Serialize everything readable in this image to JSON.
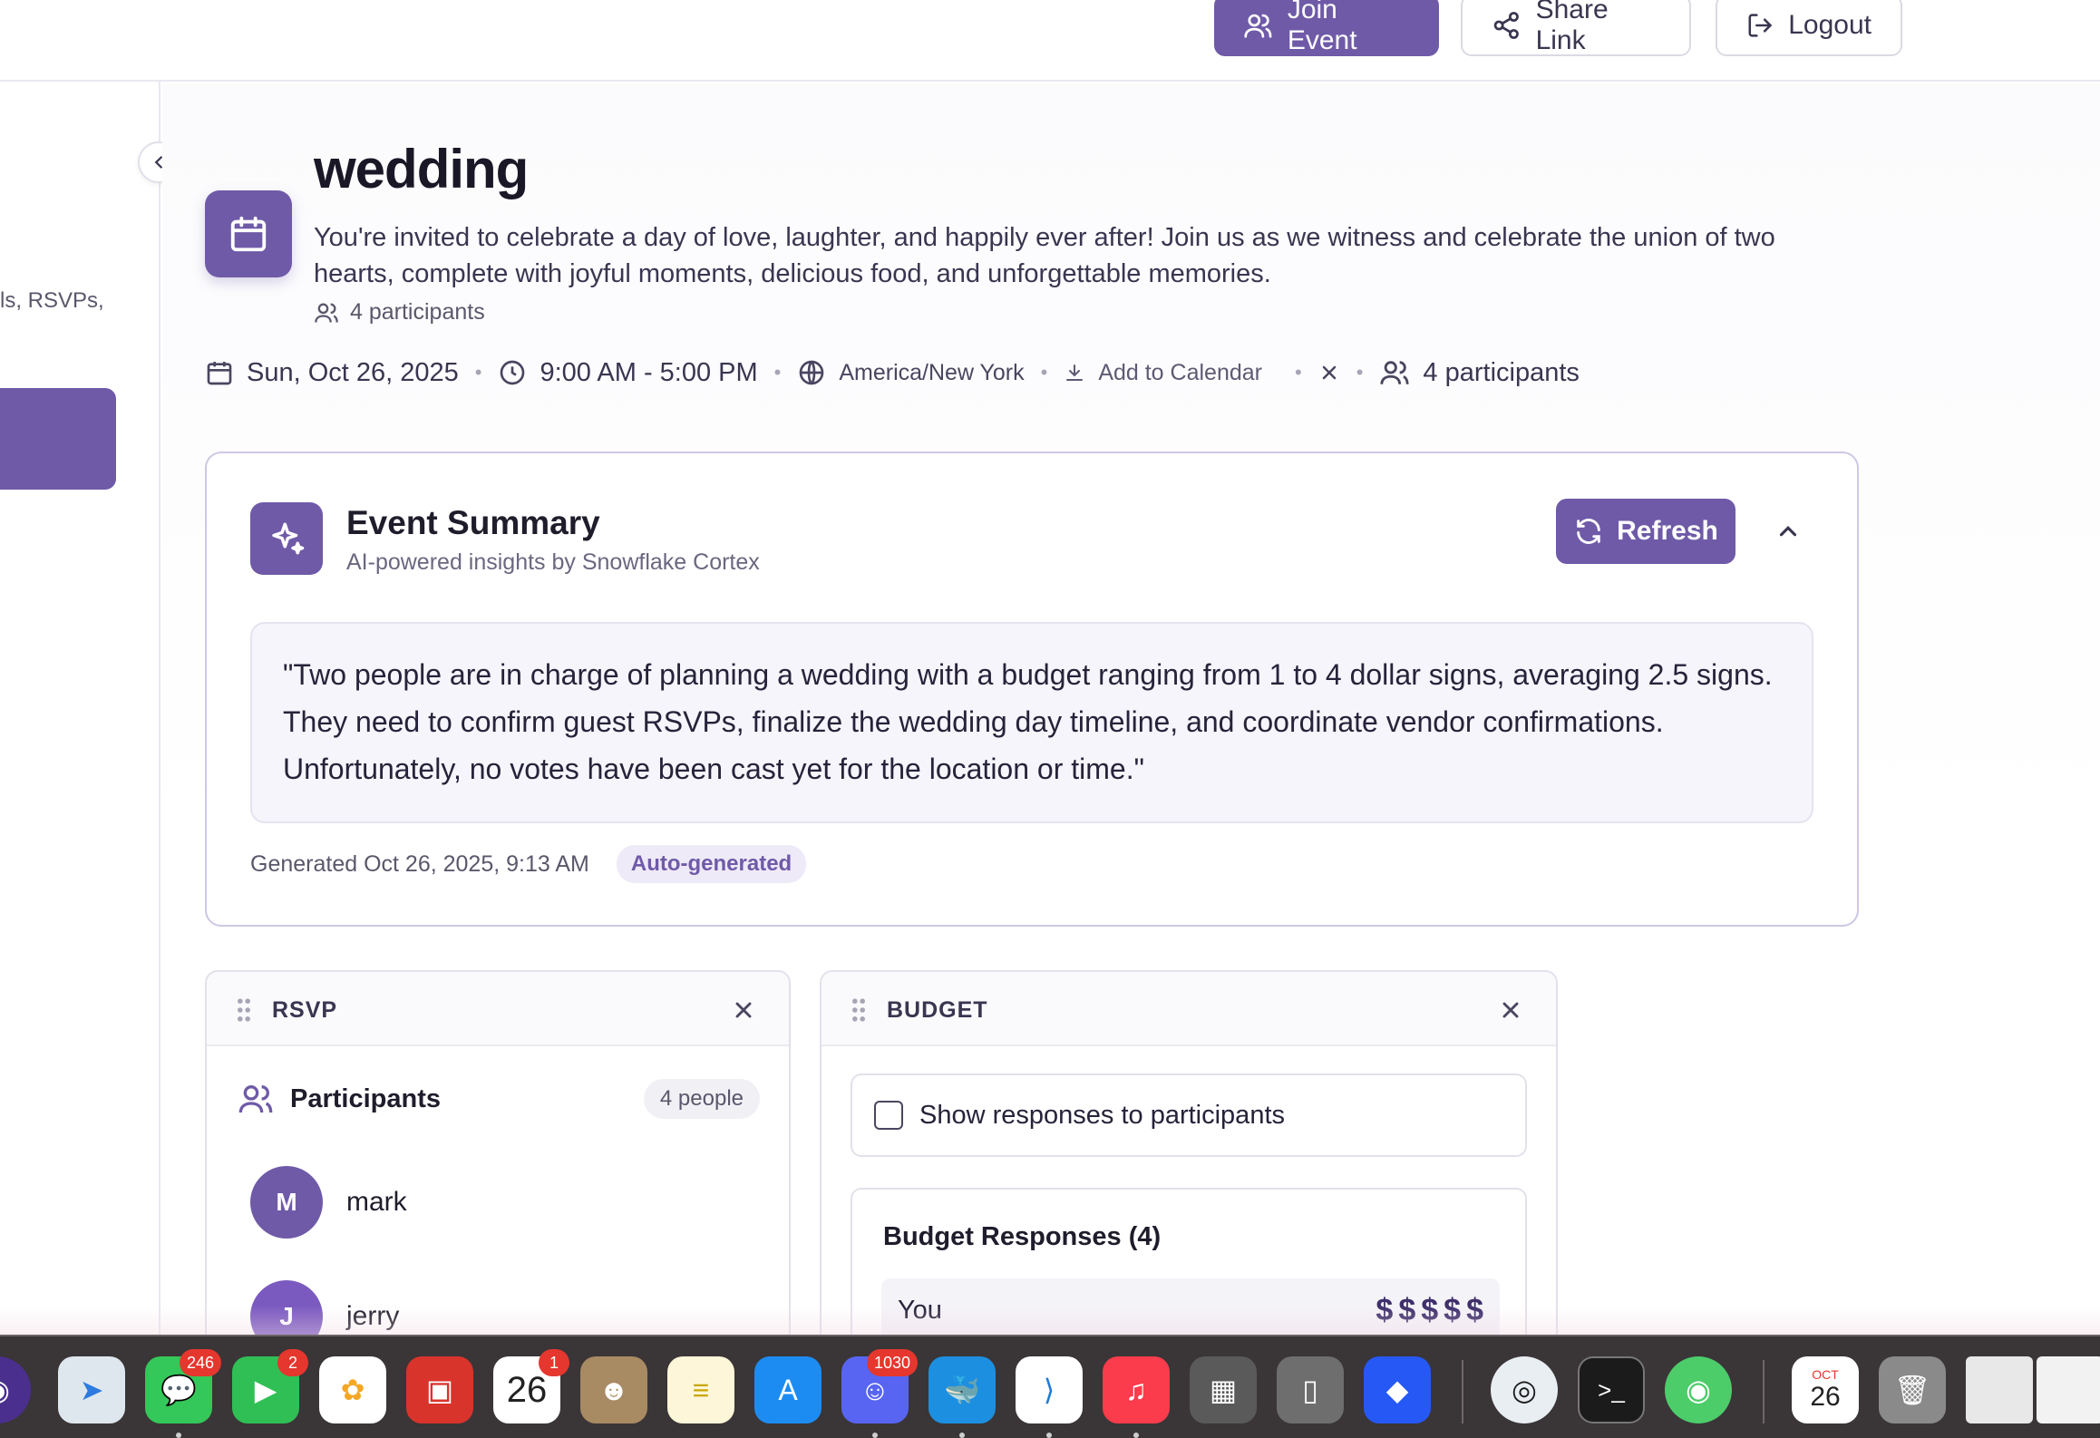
{
  "header": {
    "join_label": "Join Event",
    "share_label": "Share Link",
    "logout_label": "Logout"
  },
  "sidebar": {
    "partial_text": "ls, RSVPs,"
  },
  "event": {
    "title": "wedding",
    "description": "You're invited to celebrate a day of love, laughter, and happily ever after! Join us as we witness and celebrate the union of two hearts, complete with joyful moments, delicious food, and unforgettable memories.",
    "participants_small": "4 participants",
    "date": "Sun, Oct 26, 2025",
    "time": "9:00 AM - 5:00 PM",
    "timezone": "America/New York",
    "add_calendar": "Add to Calendar",
    "participants": "4 participants"
  },
  "summary": {
    "title": "Event Summary",
    "subtitle": "AI-powered insights by Snowflake Cortex",
    "refresh_label": "Refresh",
    "text": "\"Two people are in charge of planning a wedding with a budget ranging from 1 to 4 dollar signs, averaging 2.5 signs. They need to confirm guest RSVPs, finalize the wedding day timeline, and coordinate vendor confirmations. Unfortunately, no votes have been cast yet for the location or time.\"",
    "generated": "Generated Oct 26, 2025, 9:13 AM",
    "badge": "Auto-generated"
  },
  "rsvp": {
    "title": "RSVP",
    "participants_label": "Participants",
    "count_badge": "4 people",
    "people": [
      {
        "initial": "M",
        "name": "mark"
      },
      {
        "initial": "J",
        "name": "jerry"
      }
    ]
  },
  "budget": {
    "title": "BUDGET",
    "show_label": "Show responses to participants",
    "responses_title": "Budget Responses (4)",
    "row_name": "You",
    "dollar_count": 5
  },
  "dock": {
    "badges": {
      "messages": "246",
      "facetime": "2",
      "calendar": "1",
      "discord": "1030"
    },
    "calendar_month": "OCT",
    "calendar_day": "26"
  },
  "colors": {
    "accent": "#6f5aa8",
    "dock": "#3a3537"
  }
}
